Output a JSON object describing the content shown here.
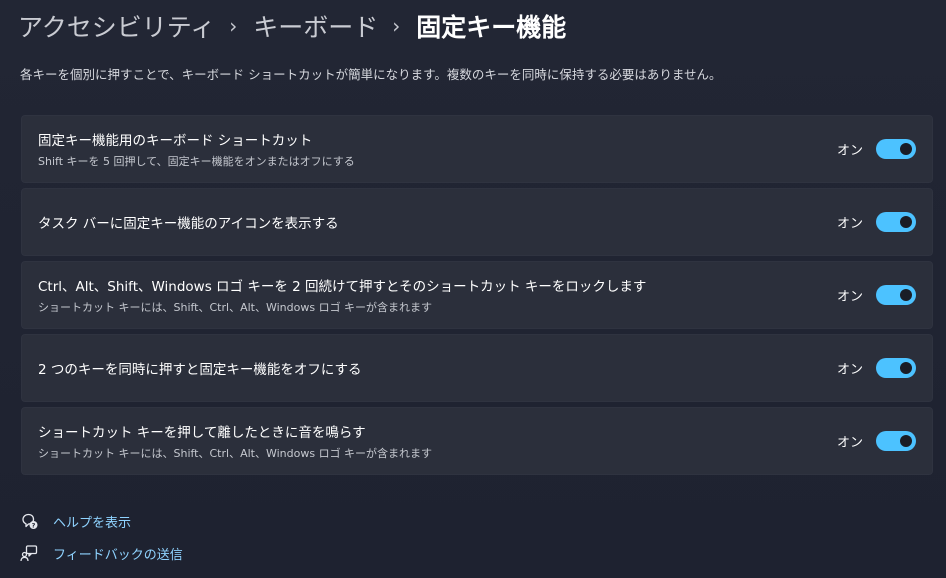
{
  "breadcrumb": {
    "items": [
      "アクセシビリティ",
      "キーボード"
    ],
    "current": "固定キー機能",
    "separator": "›"
  },
  "description": "各キーを個別に押すことで、キーボード ショートカットが簡単になります。複数のキーを同時に保持する必要はありません。",
  "settings": [
    {
      "title": "固定キー機能用のキーボード ショートカット",
      "subtitle": "Shift キーを 5 回押して、固定キー機能をオンまたはオフにする",
      "state_label": "オン",
      "on": true
    },
    {
      "title": "タスク バーに固定キー機能のアイコンを表示する",
      "subtitle": "",
      "state_label": "オン",
      "on": true
    },
    {
      "title": "Ctrl、Alt、Shift、Windows ロゴ キーを 2 回続けて押すとそのショートカット キーをロックします",
      "subtitle": "ショートカット キーには、Shift、Ctrl、Alt、Windows ロゴ キーが含まれます",
      "state_label": "オン",
      "on": true
    },
    {
      "title": "2 つのキーを同時に押すと固定キー機能をオフにする",
      "subtitle": "",
      "state_label": "オン",
      "on": true
    },
    {
      "title": "ショートカット キーを押して離したときに音を鳴らす",
      "subtitle": "ショートカット キーには、Shift、Ctrl、Alt、Windows ロゴ キーが含まれます",
      "state_label": "オン",
      "on": true
    }
  ],
  "links": {
    "help": {
      "label": "ヘルプを表示",
      "icon": "help-icon"
    },
    "feedback": {
      "label": "フィードバックの送信",
      "icon": "feedback-icon"
    }
  },
  "colors": {
    "accent": "#4cc2ff",
    "background": "#1f2330",
    "card": "#2b2f3b",
    "link": "#8fd3ff"
  }
}
